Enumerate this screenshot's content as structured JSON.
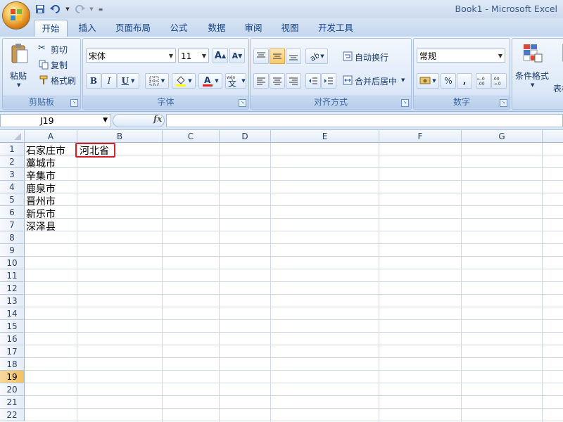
{
  "window": {
    "title": "Book1 - Microsoft Excel"
  },
  "tabs": [
    "开始",
    "插入",
    "页面布局",
    "公式",
    "数据",
    "审阅",
    "视图",
    "开发工具"
  ],
  "ribbon": {
    "clipboard": {
      "paste": "粘贴",
      "cut": "剪切",
      "copy": "复制",
      "format_painter": "格式刷",
      "label": "剪贴板"
    },
    "font": {
      "name": "宋体",
      "size": "11",
      "bold": "B",
      "italic": "I",
      "underline": "U",
      "phonetic": "wén",
      "label": "字体"
    },
    "alignment": {
      "wrap": "自动换行",
      "merge": "合并后居中",
      "label": "对齐方式"
    },
    "number": {
      "format": "常规",
      "percent": "%",
      "comma": ",",
      "label": "数字"
    },
    "styles": {
      "conditional": "条件格式",
      "table": "表格"
    }
  },
  "formula_bar": {
    "name_box": "J19",
    "fx": "fx",
    "value": ""
  },
  "grid": {
    "columns": [
      "A",
      "B",
      "C",
      "D",
      "E",
      "F",
      "G"
    ],
    "rows": [
      "1",
      "2",
      "3",
      "4",
      "5",
      "6",
      "7",
      "8",
      "9",
      "10",
      "11",
      "12",
      "13",
      "14",
      "15",
      "16",
      "17",
      "18",
      "19",
      "20",
      "21",
      "22"
    ],
    "active_row": "19",
    "cells": {
      "A1": "石家庄市",
      "B1": "河北省",
      "A2": "藁城市",
      "A3": "辛集市",
      "A4": "鹿泉市",
      "A5": "晋州市",
      "A6": "新乐市",
      "A7": "深泽县"
    }
  },
  "colors": {
    "accent": "#15428b",
    "highlight": "#d0202a",
    "active_header": "#f1c15f"
  }
}
